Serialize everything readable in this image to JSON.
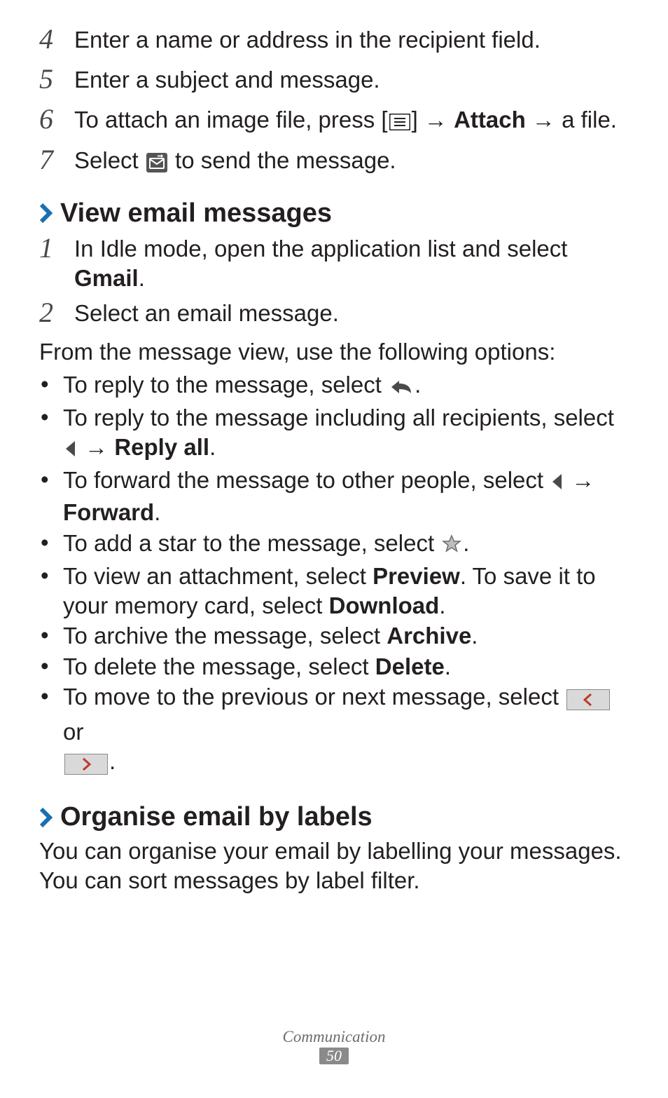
{
  "steps_top": [
    {
      "n": "4",
      "parts": [
        "Enter a name or address in the recipient field."
      ]
    },
    {
      "n": "5",
      "parts": [
        "Enter a subject and message."
      ]
    },
    {
      "n": "6",
      "parts_rich": "attach_line"
    },
    {
      "n": "7",
      "parts_rich": "send_line"
    }
  ],
  "attach_line": {
    "pre": "To attach an image file, press [",
    "post_bracket": "] → ",
    "bold": "Attach",
    "after": " → a file."
  },
  "send_line": {
    "pre": "Select ",
    "post": " to send the message."
  },
  "section1": {
    "title": "View email messages",
    "steps": [
      {
        "n": "1",
        "pre": "In Idle mode, open the application list and select ",
        "bold": "Gmail",
        "post": "."
      },
      {
        "n": "2",
        "pre": "Select an email message."
      }
    ],
    "intro": "From the message view, use the following options:",
    "bullets": {
      "reply": {
        "pre": "To reply to the message, select ",
        "post": "."
      },
      "reply_all": {
        "pre": "To reply to the message including all recipients, select ",
        "arrow": " → ",
        "bold": "Reply all",
        "post": "."
      },
      "forward": {
        "pre": "To forward the message to other people, select ",
        "arrow": " → ",
        "bold": "Forward",
        "post": "."
      },
      "star": {
        "pre": "To add a star to the message, select ",
        "post": "."
      },
      "attach": {
        "pre": "To view an attachment, select ",
        "bold1": "Preview",
        "mid": ". To save it to your memory card, select ",
        "bold2": "Download",
        "post": "."
      },
      "archive": {
        "pre": "To archive the message, select ",
        "bold": "Archive",
        "post": "."
      },
      "delete": {
        "pre": "To delete the message, select ",
        "bold": "Delete",
        "post": "."
      },
      "nav": {
        "pre": "To move to the previous or next message, select ",
        "mid": " or ",
        "post": "."
      }
    }
  },
  "section2": {
    "title": "Organise email by labels",
    "body": "You can organise your email by labelling your messages. You can sort messages by label filter."
  },
  "footer": {
    "section": "Communication",
    "page": "50"
  }
}
